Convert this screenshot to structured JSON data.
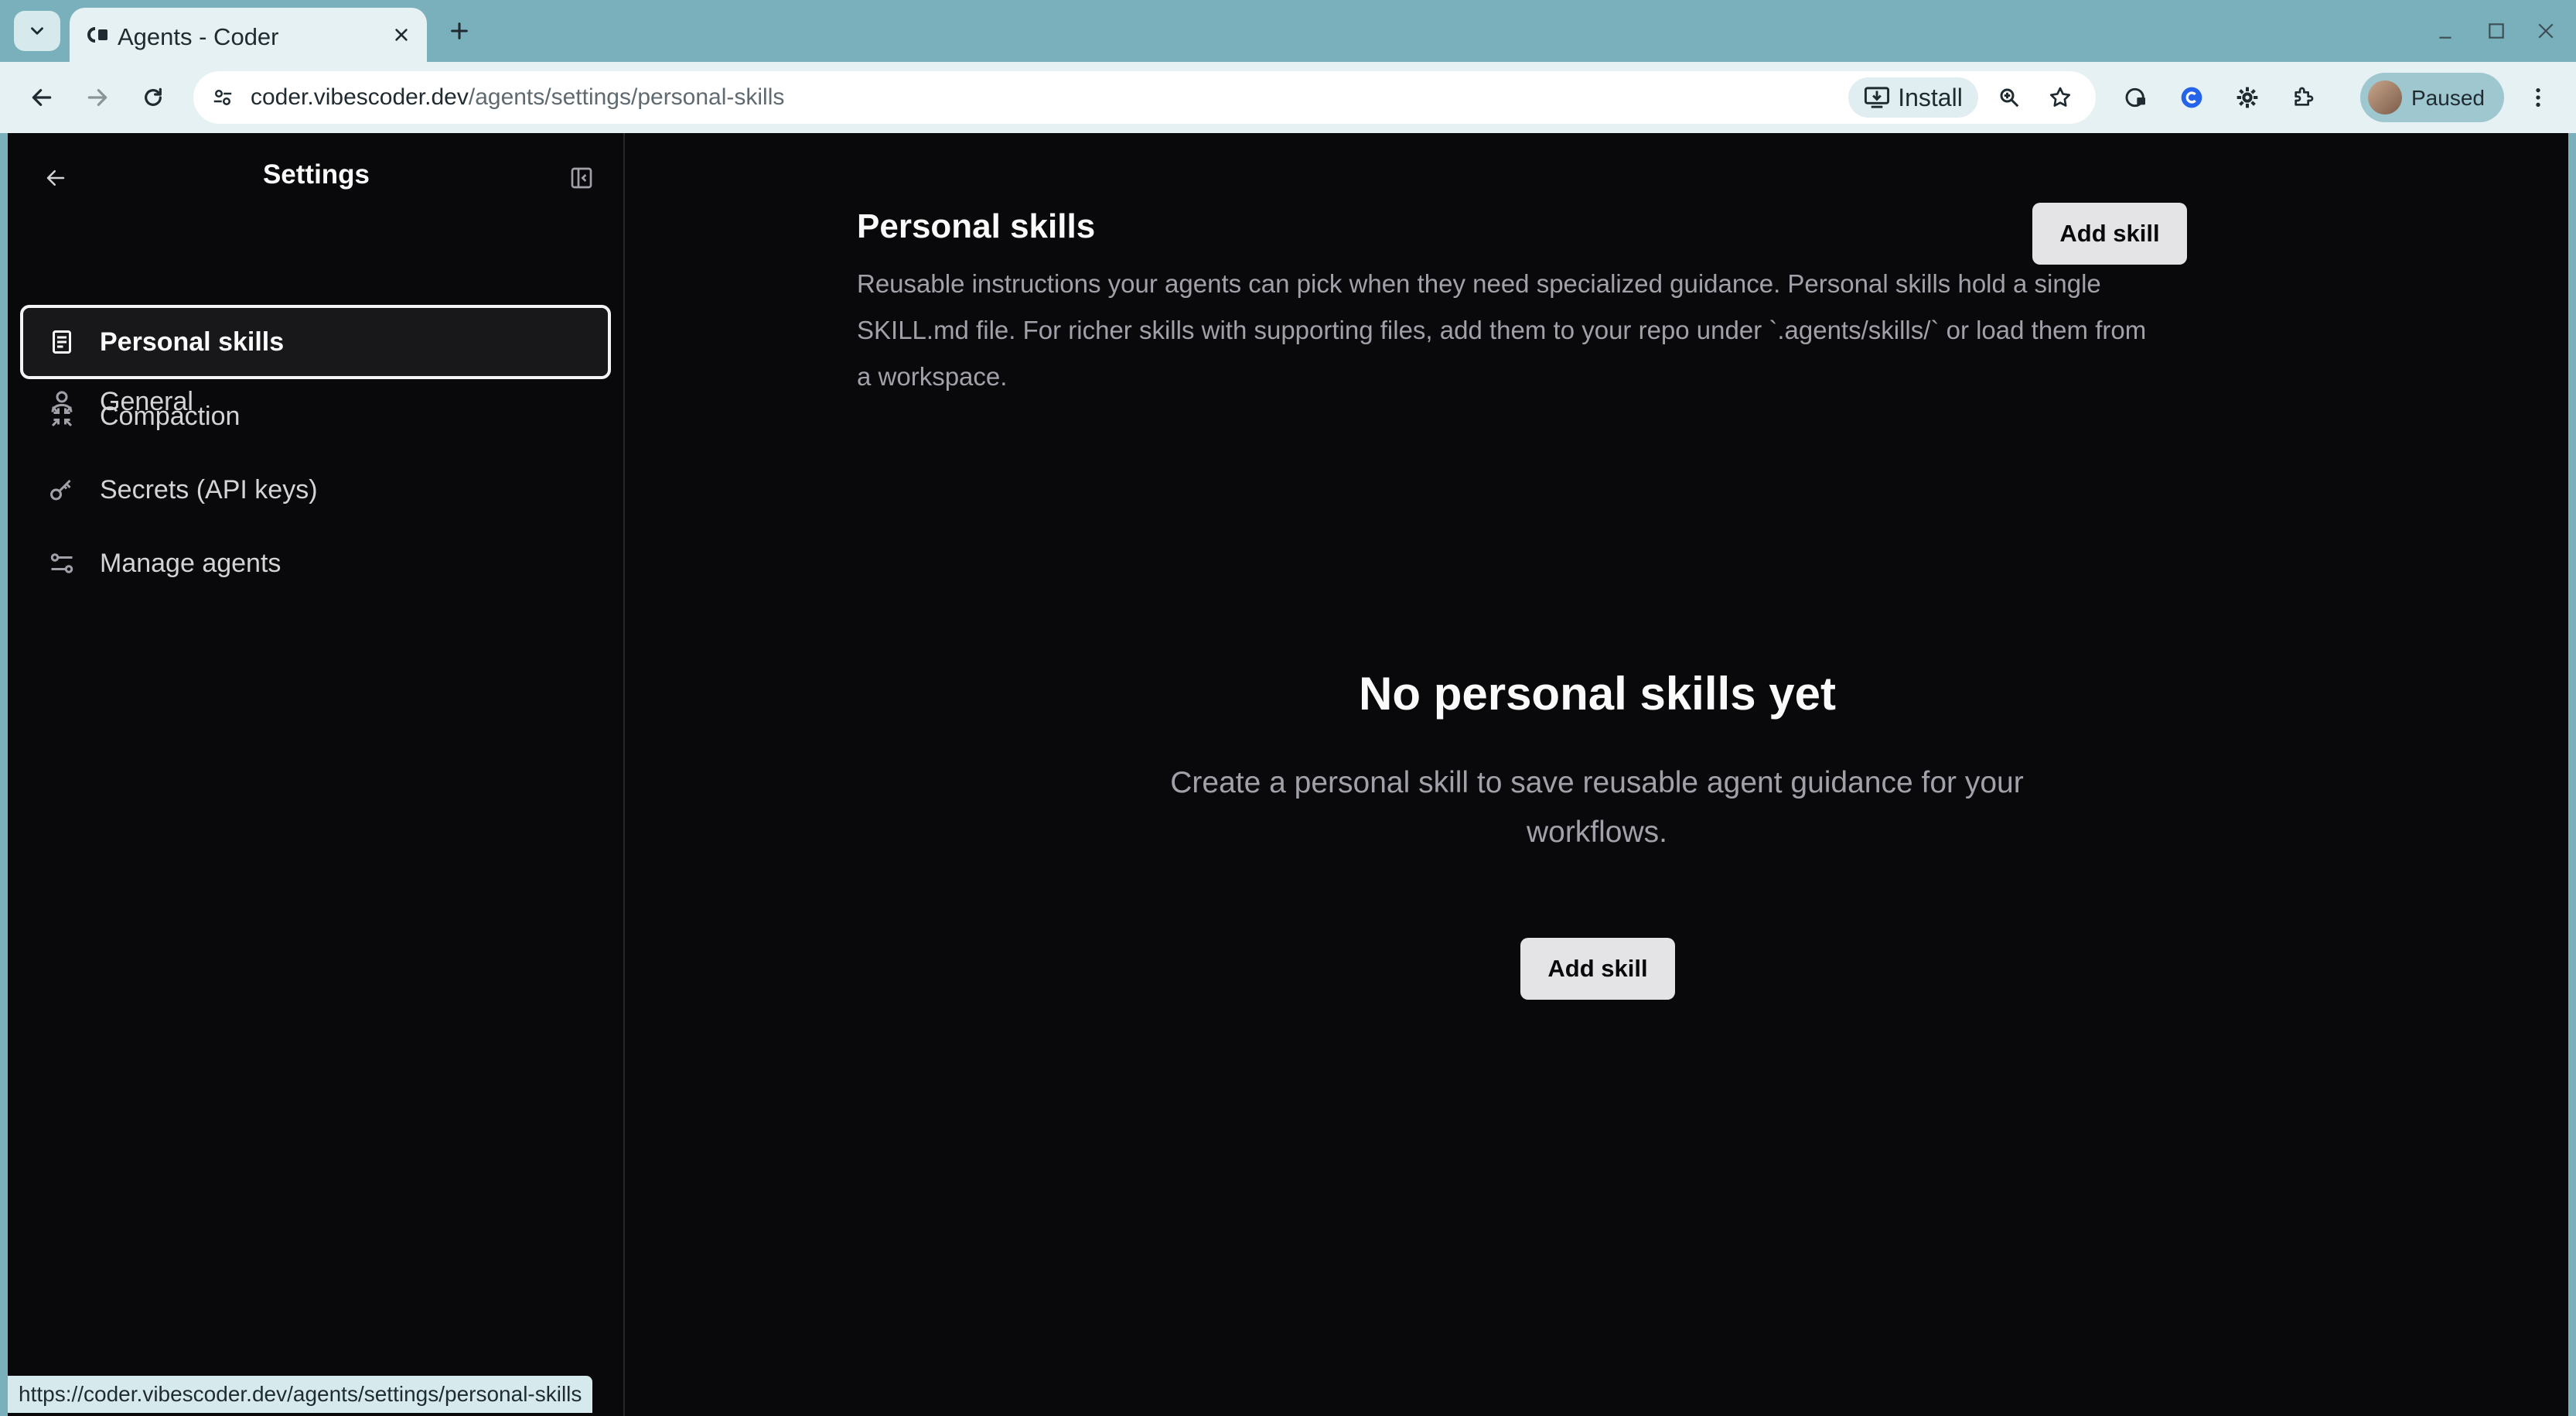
{
  "browser": {
    "tab_title": "Agents - Coder",
    "url_host": "coder.vibescoder.dev",
    "url_path": "/agents/settings/personal-skills",
    "install_label": "Install",
    "profile_label": "Paused",
    "status_url": "https://coder.vibescoder.dev/agents/settings/personal-skills"
  },
  "sidebar": {
    "title": "Settings",
    "items": [
      {
        "label": "General",
        "icon": "user-icon",
        "active": false
      },
      {
        "label": "Personal skills",
        "icon": "document-icon",
        "active": true
      },
      {
        "label": "Compaction",
        "icon": "compress-icon",
        "active": false
      },
      {
        "label": "Secrets (API keys)",
        "icon": "key-icon",
        "active": false
      },
      {
        "label": "Manage agents",
        "icon": "sliders-icon",
        "active": false
      }
    ]
  },
  "main": {
    "title": "Personal skills",
    "description": "Reusable instructions your agents can pick when they need specialized guidance. Personal skills hold a single SKILL.md file. For richer skills with supporting files, add them to your repo under `.agents/skills/` or load them from a workspace.",
    "header_button": "Add skill",
    "empty_title": "No personal skills yet",
    "empty_description": "Create a personal skill to save reusable agent guidance for your workflows.",
    "empty_button": "Add skill"
  },
  "colors": {
    "chrome": "#7ab0bc",
    "toolbar": "#e6f1f3",
    "app_bg": "#09090b",
    "text_primary": "#fafafa",
    "text_muted": "#a1a1aa",
    "button_bg": "#e4e4e7"
  }
}
